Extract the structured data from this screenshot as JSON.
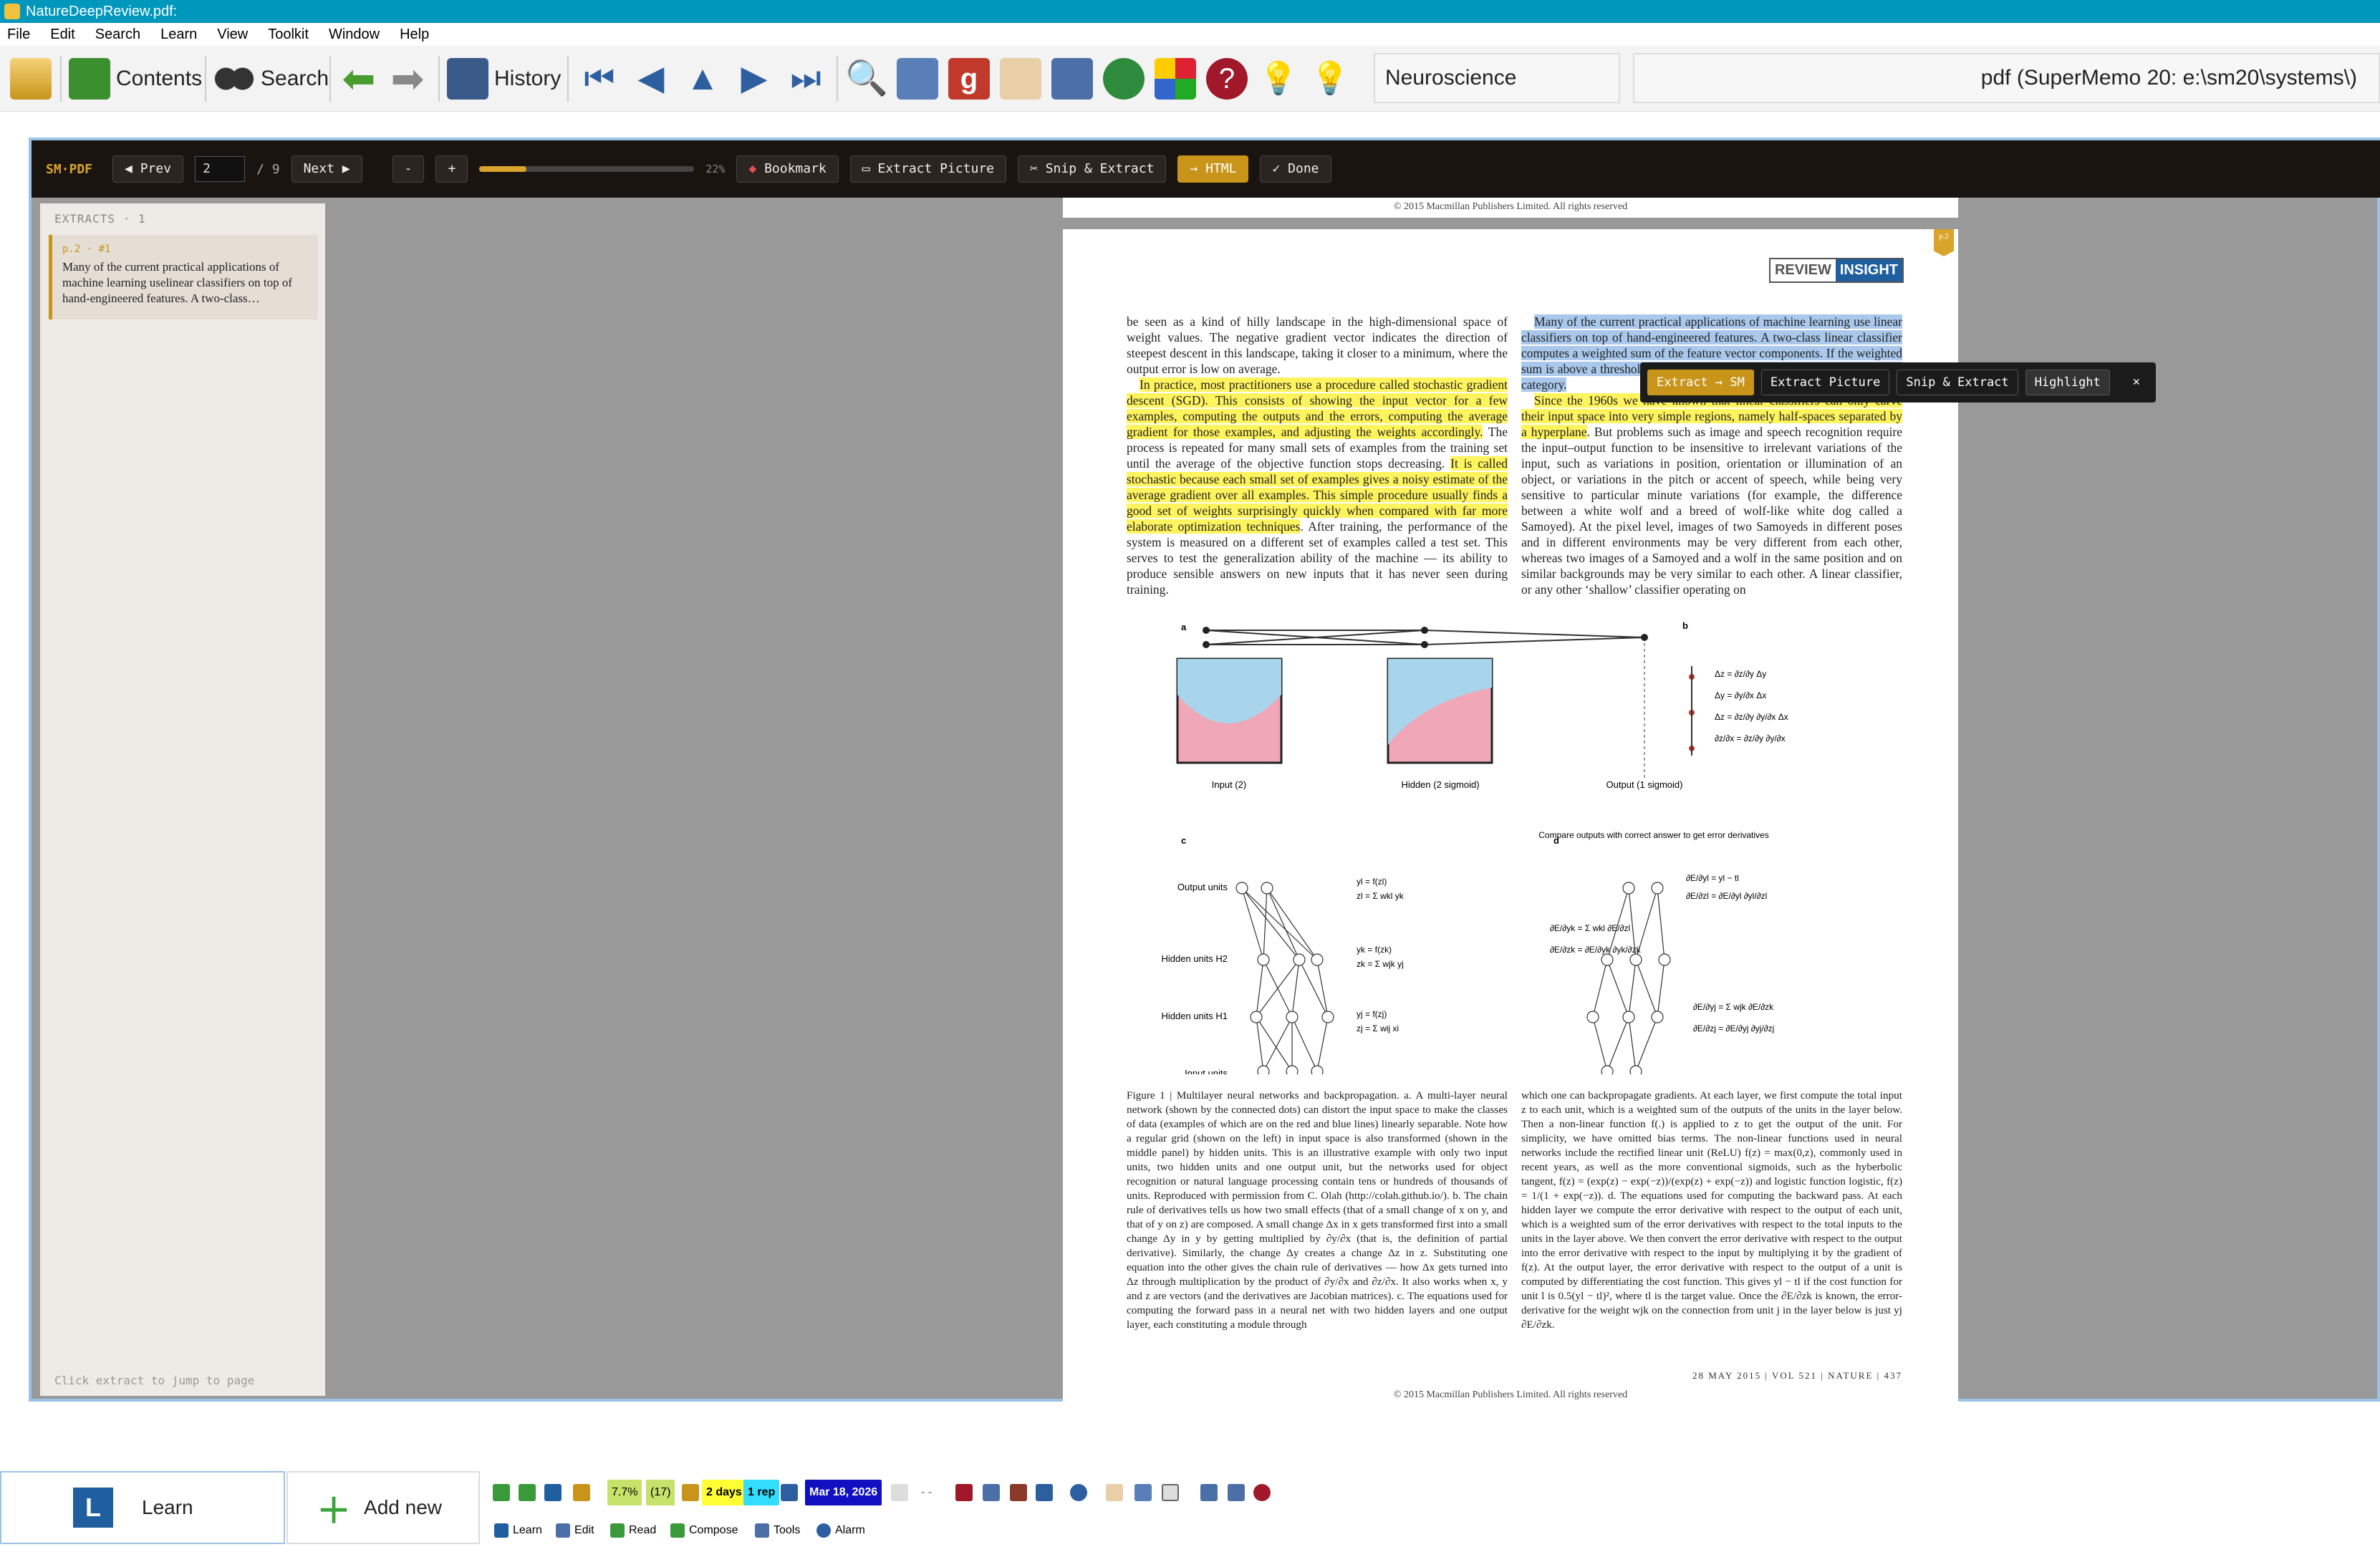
{
  "window": {
    "title": "NatureDeepReview.pdf:"
  },
  "menu": [
    "File",
    "Edit",
    "Search",
    "Learn",
    "View",
    "Toolkit",
    "Window",
    "Help"
  ],
  "toolbar": {
    "contents_label": "Contents",
    "search_label": "Search",
    "history_label": "History",
    "category_value": "Neuroscience",
    "path_value": "pdf (SuperMemo 20: e:\\sm20\\systems\\)"
  },
  "smpdf": {
    "brand": "SM·PDF",
    "prev_label": "◀ Prev",
    "page_value": "2",
    "page_total": "/ 9",
    "next_label": "Next ▶",
    "zoom_out": "-",
    "zoom_in": "+",
    "zoom_percent": "22%",
    "zoom_fraction": 0.22,
    "bookmark_label": "Bookmark",
    "extract_picture_label": "Extract Picture",
    "snip_label": "Snip & Extract",
    "html_label": "→ HTML",
    "done_label": "✓ Done"
  },
  "sidebar": {
    "header": "EXTRACTS · 1",
    "extract_page": "p.2 · #1",
    "extract_text": "Many of the current practical applications of machine learning uselinear classifiers on top of hand-engineered features. A two-class…",
    "footer": "Click extract to jump to page"
  },
  "page": {
    "copyright_top": "© 2015 Macmillan Publishers Limited. All rights reserved",
    "copyright_bottom": "© 2015 Macmillan Publishers Limited. All rights reserved",
    "page_tag": "p.2",
    "badge_review": "REVIEW",
    "badge_insight": "INSIGHT",
    "left_p1": "be seen as a kind of hilly landscape in the high-dimensional space of weight values. The negative gradient vector indicates the direction of steepest descent in this landscape, taking it closer to a minimum, where the output error is low on average.",
    "left_p2_hl": "In practice, most practitioners use a procedure called stochastic gradient descent (SGD). This consists of showing the input vector for a few examples, computing the outputs and the errors, computing the average gradient for those examples, and adjusting the weights accordingly.",
    "left_p2_rest": " The process is repeated for many small sets of examples from the training set until the average of the objective function stops decreasing. ",
    "left_p2_hl2": "It is called stochastic because each small set of examples gives a noisy estimate of the average gradient over all examples. This simple procedure usually finds a good set of weights surprisingly quickly when compared with far more elaborate optimization techniques",
    "left_p2_end": ". After training, the performance of the system is measured on a different set of examples called a test set. This serves to test the generalization ability of the machine — its ability to produce sensible answers on new inputs that it has never seen during training.",
    "right_p1_blue": "Many of the current practical applications of machine learning use linear classifiers on top of hand-engineered features. A two-class linear classifier computes a weighted sum of the feature vector components. If the weighted sum is above a threshold, the input is classified as belonging to a particular category.",
    "right_p2_hl": "Since the 1960s we have known that linear classifiers can only carve their input space into very simple regions, namely half-spaces separated by a hyperplane",
    "right_p2_rest": ". But problems such as image and speech recognition require the input–output function to be insensitive to irrelevant variations of the input, such as variations in position, orientation or illumination of an object, or variations in the pitch or accent of speech, while being very sensitive to particular minute variations (for example, the difference between a white wolf and a breed of wolf-like white dog called a Samoyed). At the pixel level, images of two Samoyeds in different poses and in different environments may be very different from each other, whereas two images of a Samoyed and a wolf in the same position and on similar backgrounds may be very similar to each other. A linear classifier, or any other ‘shallow’ classifier operating on",
    "fig_a": "a",
    "fig_b": "b",
    "fig_c": "c",
    "fig_d": "d",
    "fig_input": "Input (2)",
    "fig_hidden": "Hidden (2 sigmoid)",
    "fig_output": "Output (1 sigmoid)",
    "fig_c_output": "Output units",
    "fig_c_h2": "Hidden units H2",
    "fig_c_h1": "Hidden units H1",
    "fig_c_input": "Input units",
    "fig_d_title": "Compare outputs with correct answer to get error derivatives",
    "caption_left": "Figure 1 | Multilayer neural networks and backpropagation. a. A multi-layer neural network (shown by the connected dots) can distort the input space to make the classes of data (examples of which are on the red and blue lines) linearly separable. Note how a regular grid (shown on the left) in input space is also transformed (shown in the middle panel) by hidden units. This is an illustrative example with only two input units, two hidden units and one output unit, but the networks used for object recognition or natural language processing contain tens or hundreds of thousands of units. Reproduced with permission from C. Olah (http://colah.github.io/). b. The chain rule of derivatives tells us how two small effects (that of a small change of x on y, and that of y on z) are composed. A small change Δx in x gets transformed first into a small change Δy in y by getting multiplied by ∂y/∂x (that is, the definition of partial derivative). Similarly, the change Δy creates a change Δz in z. Substituting one equation into the other gives the chain rule of derivatives — how Δx gets turned into Δz through multiplication by the product of ∂y/∂x and ∂z/∂x. It also works when x, y and z are vectors (and the derivatives are Jacobian matrices). c. The equations used for computing the forward pass in a neural net with two hidden layers and one output layer, each constituting a module through",
    "caption_right": "which one can backpropagate gradients. At each layer, we first compute the total input z to each unit, which is a weighted sum of the outputs of the units in the layer below. Then a non-linear function f(.) is applied to z to get the output of the unit. For simplicity, we have omitted bias terms. The non-linear functions used in neural networks include the rectified linear unit (ReLU) f(z) = max(0,z), commonly used in recent years, as well as the more conventional sigmoids, such as the hyberbolic tangent, f(z) = (exp(z) − exp(−z))/(exp(z) + exp(−z)) and logistic function logistic, f(z) = 1/(1 + exp(−z)). d. The equations used for computing the backward pass. At each hidden layer we compute the error derivative with respect to the output of each unit, which is a weighted sum of the error derivatives with respect to the total inputs to the units in the layer above. We then convert the error derivative with respect to the output into the error derivative with respect to the input by multiplying it by the gradient of f(z). At the output layer, the error derivative with respect to the output of a unit is computed by differentiating the cost function. This gives yl − tl if the cost function for unit l is 0.5(yl − tl)², where tl is the target value. Once the ∂E/∂zk is known, the error-derivative for the weight wjk on the connection from unit j in the layer below is just yj ∂E/∂zk.",
    "footer_line": "28 MAY 2015 | VOL 521 | NATURE | 437"
  },
  "popup": {
    "extract_sm": "Extract → SM",
    "extract_picture": "Extract Picture",
    "snip": "Snip & Extract",
    "highlight": "Highlight",
    "close": "✕"
  },
  "bottom": {
    "learn_label": "Learn",
    "addnew_label": "Add new",
    "stat_pct": "7.7%",
    "stat_count": "(17)",
    "stat_days": "2 days",
    "stat_rep": "1 rep",
    "stat_date": "Mar 18, 2026",
    "stat_dashes": "- -",
    "tab_learn": "Learn",
    "tab_edit": "Edit",
    "tab_read": "Read",
    "tab_compose": "Compose",
    "tab_tools": "Tools",
    "tab_alarm": "Alarm"
  },
  "colors": {
    "titlebar": "#0097bd",
    "accent": "#c8951a",
    "highlight_yellow": "#fff45e",
    "highlight_blue": "#a9c8ec"
  }
}
